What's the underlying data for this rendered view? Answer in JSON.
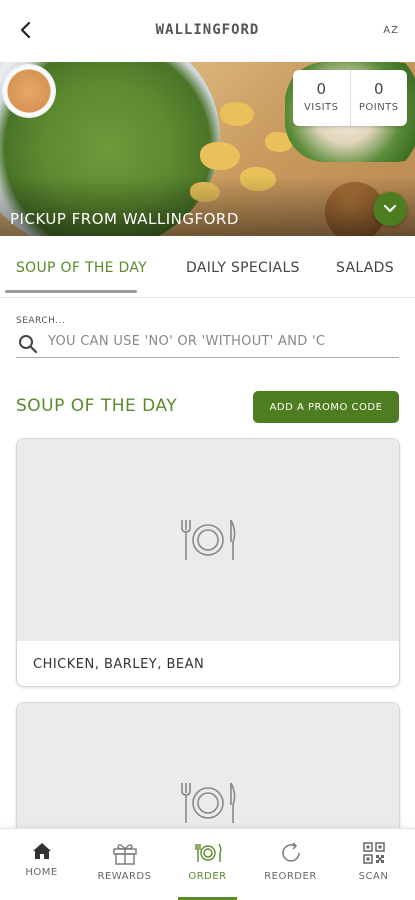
{
  "header": {
    "title": "WALLINGFORD",
    "language": "AZ"
  },
  "hero": {
    "pickup_label": "PICKUP FROM WALLINGFORD",
    "stats": [
      {
        "value": "0",
        "label": "VISITS"
      },
      {
        "value": "0",
        "label": "POINTS"
      }
    ]
  },
  "tabs": [
    {
      "label": "SOUP OF THE DAY",
      "active": true
    },
    {
      "label": "DAILY SPECIALS",
      "active": false
    },
    {
      "label": "SALADS",
      "active": false
    }
  ],
  "search": {
    "label": "SEARCH...",
    "placeholder": "YOU CAN USE 'NO' OR 'WITHOUT' AND 'C"
  },
  "section": {
    "title": "SOUP OF THE DAY",
    "promo_button": "ADD A PROMO CODE"
  },
  "items": [
    {
      "name": "CHICKEN, BARLEY, BEAN",
      "icon": "plate-cutlery-icon"
    },
    {
      "name": "",
      "icon": "plate-cutlery-icon"
    }
  ],
  "bottom_nav": [
    {
      "label": "HOME",
      "icon": "home-icon",
      "active": false
    },
    {
      "label": "REWARDS",
      "icon": "gift-icon",
      "active": false
    },
    {
      "label": "ORDER",
      "icon": "order-icon",
      "active": true
    },
    {
      "label": "REORDER",
      "icon": "reorder-icon",
      "active": false
    },
    {
      "label": "SCAN",
      "icon": "qr-code-icon",
      "active": false
    }
  ],
  "colors": {
    "accent": "#5a8a2b",
    "button": "#4e7d21"
  }
}
